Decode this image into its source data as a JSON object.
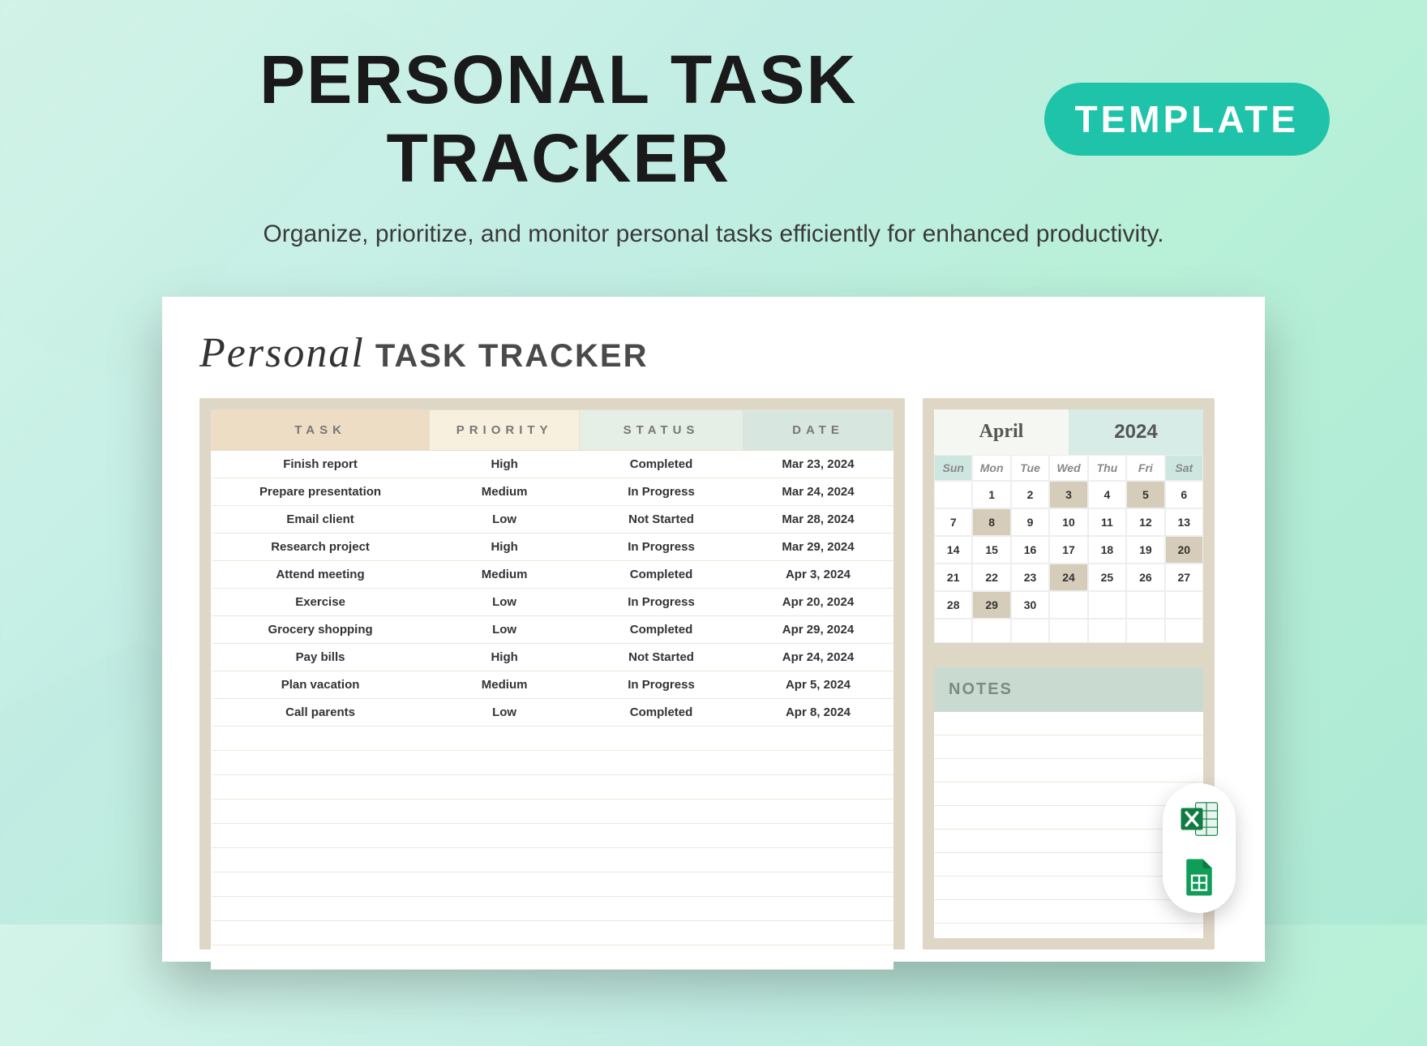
{
  "hero": {
    "title": "PERSONAL TASK TRACKER",
    "badge": "TEMPLATE",
    "sub": "Organize, prioritize, and monitor personal tasks efficiently for enhanced productivity."
  },
  "sheet": {
    "title_script": "Personal",
    "title_caps": "TASK TRACKER"
  },
  "table": {
    "headers": [
      "TASK",
      "PRIORITY",
      "STATUS",
      "DATE"
    ],
    "rows": [
      {
        "task": "Finish report",
        "priority": "High",
        "status": "Completed",
        "date": "Mar 23, 2024"
      },
      {
        "task": "Prepare presentation",
        "priority": "Medium",
        "status": "In Progress",
        "date": "Mar 24, 2024"
      },
      {
        "task": "Email client",
        "priority": "Low",
        "status": "Not Started",
        "date": "Mar 28, 2024"
      },
      {
        "task": "Research project",
        "priority": "High",
        "status": "In Progress",
        "date": "Mar 29, 2024"
      },
      {
        "task": "Attend meeting",
        "priority": "Medium",
        "status": "Completed",
        "date": "Apr 3, 2024"
      },
      {
        "task": "Exercise",
        "priority": "Low",
        "status": "In Progress",
        "date": "Apr 20, 2024"
      },
      {
        "task": "Grocery shopping",
        "priority": "Low",
        "status": "Completed",
        "date": "Apr 29, 2024"
      },
      {
        "task": "Pay bills",
        "priority": "High",
        "status": "Not Started",
        "date": "Apr 24, 2024"
      },
      {
        "task": "Plan vacation",
        "priority": "Medium",
        "status": "In Progress",
        "date": "Apr 5, 2024"
      },
      {
        "task": "Call parents",
        "priority": "Low",
        "status": "Completed",
        "date": "Apr 8, 2024"
      }
    ],
    "empty_rows": 10
  },
  "calendar": {
    "month": "April",
    "year": "2024",
    "dows": [
      "Sun",
      "Mon",
      "Tue",
      "Wed",
      "Thu",
      "Fri",
      "Sat"
    ],
    "cells": [
      {
        "n": "",
        "dim": true
      },
      {
        "n": "1"
      },
      {
        "n": "2"
      },
      {
        "n": "3",
        "sel": true
      },
      {
        "n": "4"
      },
      {
        "n": "5",
        "sel": true
      },
      {
        "n": "6"
      },
      {
        "n": "7"
      },
      {
        "n": "8",
        "sel": true
      },
      {
        "n": "9"
      },
      {
        "n": "10"
      },
      {
        "n": "11"
      },
      {
        "n": "12"
      },
      {
        "n": "13"
      },
      {
        "n": "14"
      },
      {
        "n": "15"
      },
      {
        "n": "16"
      },
      {
        "n": "17"
      },
      {
        "n": "18"
      },
      {
        "n": "19"
      },
      {
        "n": "20",
        "sel": true
      },
      {
        "n": "21"
      },
      {
        "n": "22"
      },
      {
        "n": "23"
      },
      {
        "n": "24",
        "sel": true
      },
      {
        "n": "25"
      },
      {
        "n": "26"
      },
      {
        "n": "27"
      },
      {
        "n": "28"
      },
      {
        "n": "29",
        "sel": true
      },
      {
        "n": "30"
      },
      {
        "n": "",
        "dim": true
      },
      {
        "n": "",
        "dim": true
      },
      {
        "n": "",
        "dim": true
      },
      {
        "n": "",
        "dim": true
      },
      {
        "n": "",
        "dim": true
      },
      {
        "n": "",
        "dim": true
      },
      {
        "n": "",
        "dim": true
      },
      {
        "n": "",
        "dim": true
      },
      {
        "n": "",
        "dim": true
      },
      {
        "n": "",
        "dim": true
      },
      {
        "n": "",
        "dim": true
      }
    ]
  },
  "notes": {
    "title": "NOTES"
  },
  "formats": {
    "excel": "Excel",
    "sheets": "Google Sheets"
  }
}
